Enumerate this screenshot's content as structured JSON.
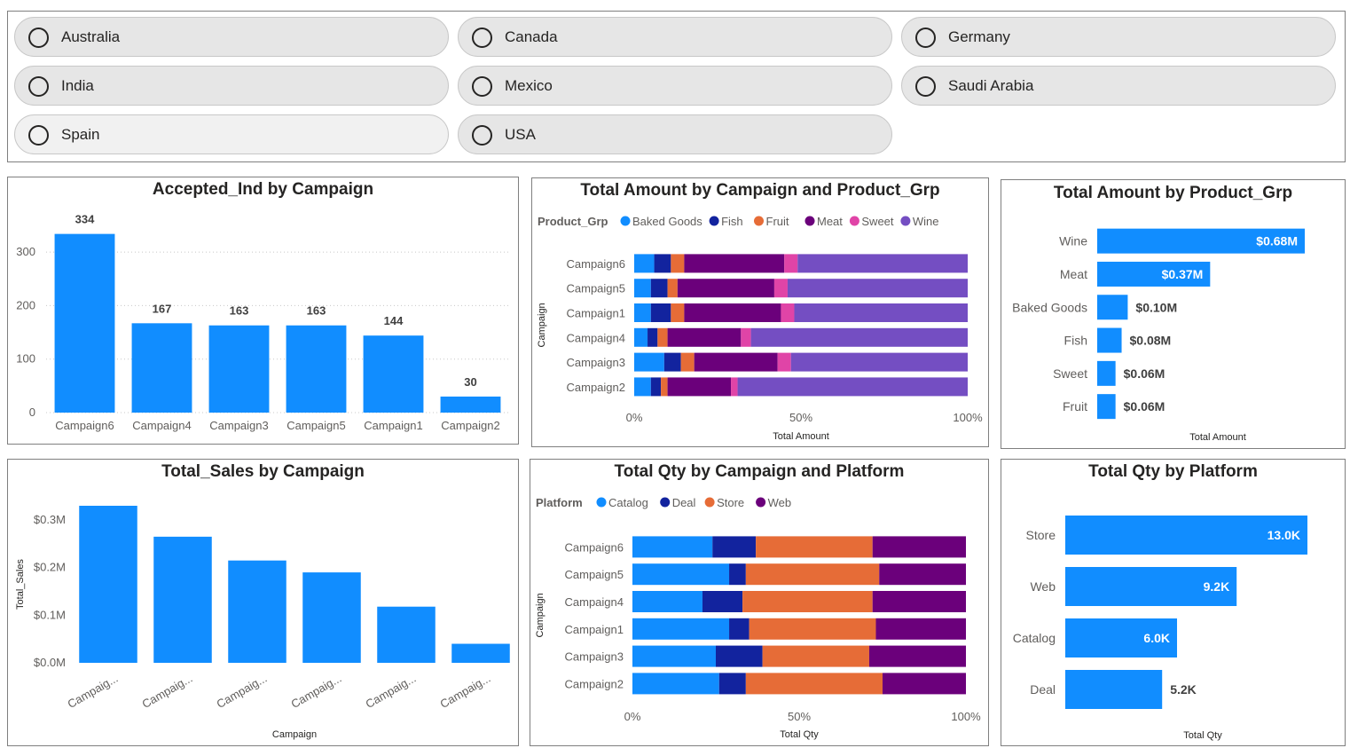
{
  "slicer": {
    "options": [
      "Australia",
      "Canada",
      "Germany",
      "India",
      "Mexico",
      "Saudi Arabia",
      "Spain",
      "USA"
    ]
  },
  "colors": {
    "primary": "#118DFF",
    "catalog": "#118DFF",
    "deal": "#12239E",
    "store": "#E66C37",
    "web": "#6B007B",
    "baked_goods": "#118DFF",
    "fish": "#12239E",
    "fruit": "#E66C37",
    "meat": "#6B007B",
    "sweet": "#E044A7",
    "wine": "#744EC2"
  },
  "charts": {
    "accepted": {
      "title": "Accepted_Ind by Campaign",
      "chart_data": {
        "type": "bar",
        "categories": [
          "Campaign6",
          "Campaign4",
          "Campaign3",
          "Campaign5",
          "Campaign1",
          "Campaign2"
        ],
        "values": [
          334,
          167,
          163,
          163,
          144,
          30
        ],
        "value_labels": [
          "334",
          "167",
          "163",
          "163",
          "144",
          "30"
        ],
        "ylim": [
          0,
          345
        ],
        "yticks": [
          0,
          100,
          200,
          300
        ],
        "ytick_labels": [
          "0",
          "100",
          "200",
          "300"
        ],
        "grid": true,
        "xlabel": "",
        "ylabel": ""
      }
    },
    "amount_campaign": {
      "title": "Total Amount by Campaign and Product_Grp",
      "legend_title": "Product_Grp",
      "chart_data": {
        "type": "bar",
        "orientation": "horizontal",
        "stacked": "percent",
        "categories": [
          "Campaign6",
          "Campaign5",
          "Campaign1",
          "Campaign4",
          "Campaign3",
          "Campaign2"
        ],
        "series": [
          {
            "name": "Baked Goods",
            "values": [
              6,
              5,
              5,
              4,
              9,
              5
            ]
          },
          {
            "name": "Fish",
            "values": [
              5,
              5,
              6,
              3,
              5,
              3
            ]
          },
          {
            "name": "Fruit",
            "values": [
              4,
              3,
              4,
              3,
              4,
              2
            ]
          },
          {
            "name": "Meat",
            "values": [
              30,
              29,
              29,
              22,
              25,
              19
            ]
          },
          {
            "name": "Sweet",
            "values": [
              4,
              4,
              4,
              3,
              4,
              2
            ]
          },
          {
            "name": "Wine",
            "values": [
              51,
              54,
              52,
              65,
              53,
              69
            ]
          }
        ],
        "xticks": [
          "0%",
          "50%",
          "100%"
        ],
        "xlabel": "Total Amount",
        "ylabel": "Campaign"
      }
    },
    "amount_product": {
      "title": "Total Amount by Product_Grp",
      "chart_data": {
        "type": "bar",
        "orientation": "horizontal",
        "categories": [
          "Wine",
          "Meat",
          "Baked Goods",
          "Fish",
          "Sweet",
          "Fruit"
        ],
        "values": [
          0.68,
          0.37,
          0.1,
          0.08,
          0.06,
          0.06
        ],
        "value_labels": [
          "$0.68M",
          "$0.37M",
          "$0.10M",
          "$0.08M",
          "$0.06M",
          "$0.06M"
        ],
        "xmax": 0.68,
        "xlabel": "Total Amount"
      }
    },
    "sales": {
      "title": "Total_Sales by Campaign",
      "chart_data": {
        "type": "bar",
        "categories": [
          "Campaig...",
          "Campaig...",
          "Campaig...",
          "Campaig...",
          "Campaig...",
          "Campaig..."
        ],
        "values": [
          0.33,
          0.265,
          0.215,
          0.19,
          0.118,
          0.04
        ],
        "ylim": [
          0,
          0.33
        ],
        "yticks": [
          0,
          0.1,
          0.2,
          0.3
        ],
        "ytick_labels": [
          "$0.0M",
          "$0.1M",
          "$0.2M",
          "$0.3M"
        ],
        "xlabel": "Campaign",
        "ylabel": "Total_Sales"
      }
    },
    "qty_campaign": {
      "title": "Total Qty by Campaign and Platform",
      "legend_title": "Platform",
      "chart_data": {
        "type": "bar",
        "orientation": "horizontal",
        "stacked": "percent",
        "categories": [
          "Campaign6",
          "Campaign5",
          "Campaign4",
          "Campaign1",
          "Campaign3",
          "Campaign2"
        ],
        "series": [
          {
            "name": "Catalog",
            "values": [
              24,
              29,
              21,
              29,
              25,
              26
            ]
          },
          {
            "name": "Deal",
            "values": [
              13,
              5,
              12,
              6,
              14,
              8
            ]
          },
          {
            "name": "Store",
            "values": [
              35,
              40,
              39,
              38,
              32,
              41
            ]
          },
          {
            "name": "Web",
            "values": [
              28,
              26,
              28,
              27,
              29,
              25
            ]
          }
        ],
        "xticks": [
          "0%",
          "50%",
          "100%"
        ],
        "xlabel": "Total Qty",
        "ylabel": "Campaign"
      }
    },
    "qty_platform": {
      "title": "Total Qty by Platform",
      "chart_data": {
        "type": "bar",
        "orientation": "horizontal",
        "categories": [
          "Store",
          "Web",
          "Catalog",
          "Deal"
        ],
        "values": [
          13.0,
          9.2,
          6.0,
          5.2
        ],
        "value_labels": [
          "13.0K",
          "9.2K",
          "6.0K",
          "5.2K"
        ],
        "xmax": 13.0,
        "xlabel": "Total Qty"
      }
    }
  }
}
